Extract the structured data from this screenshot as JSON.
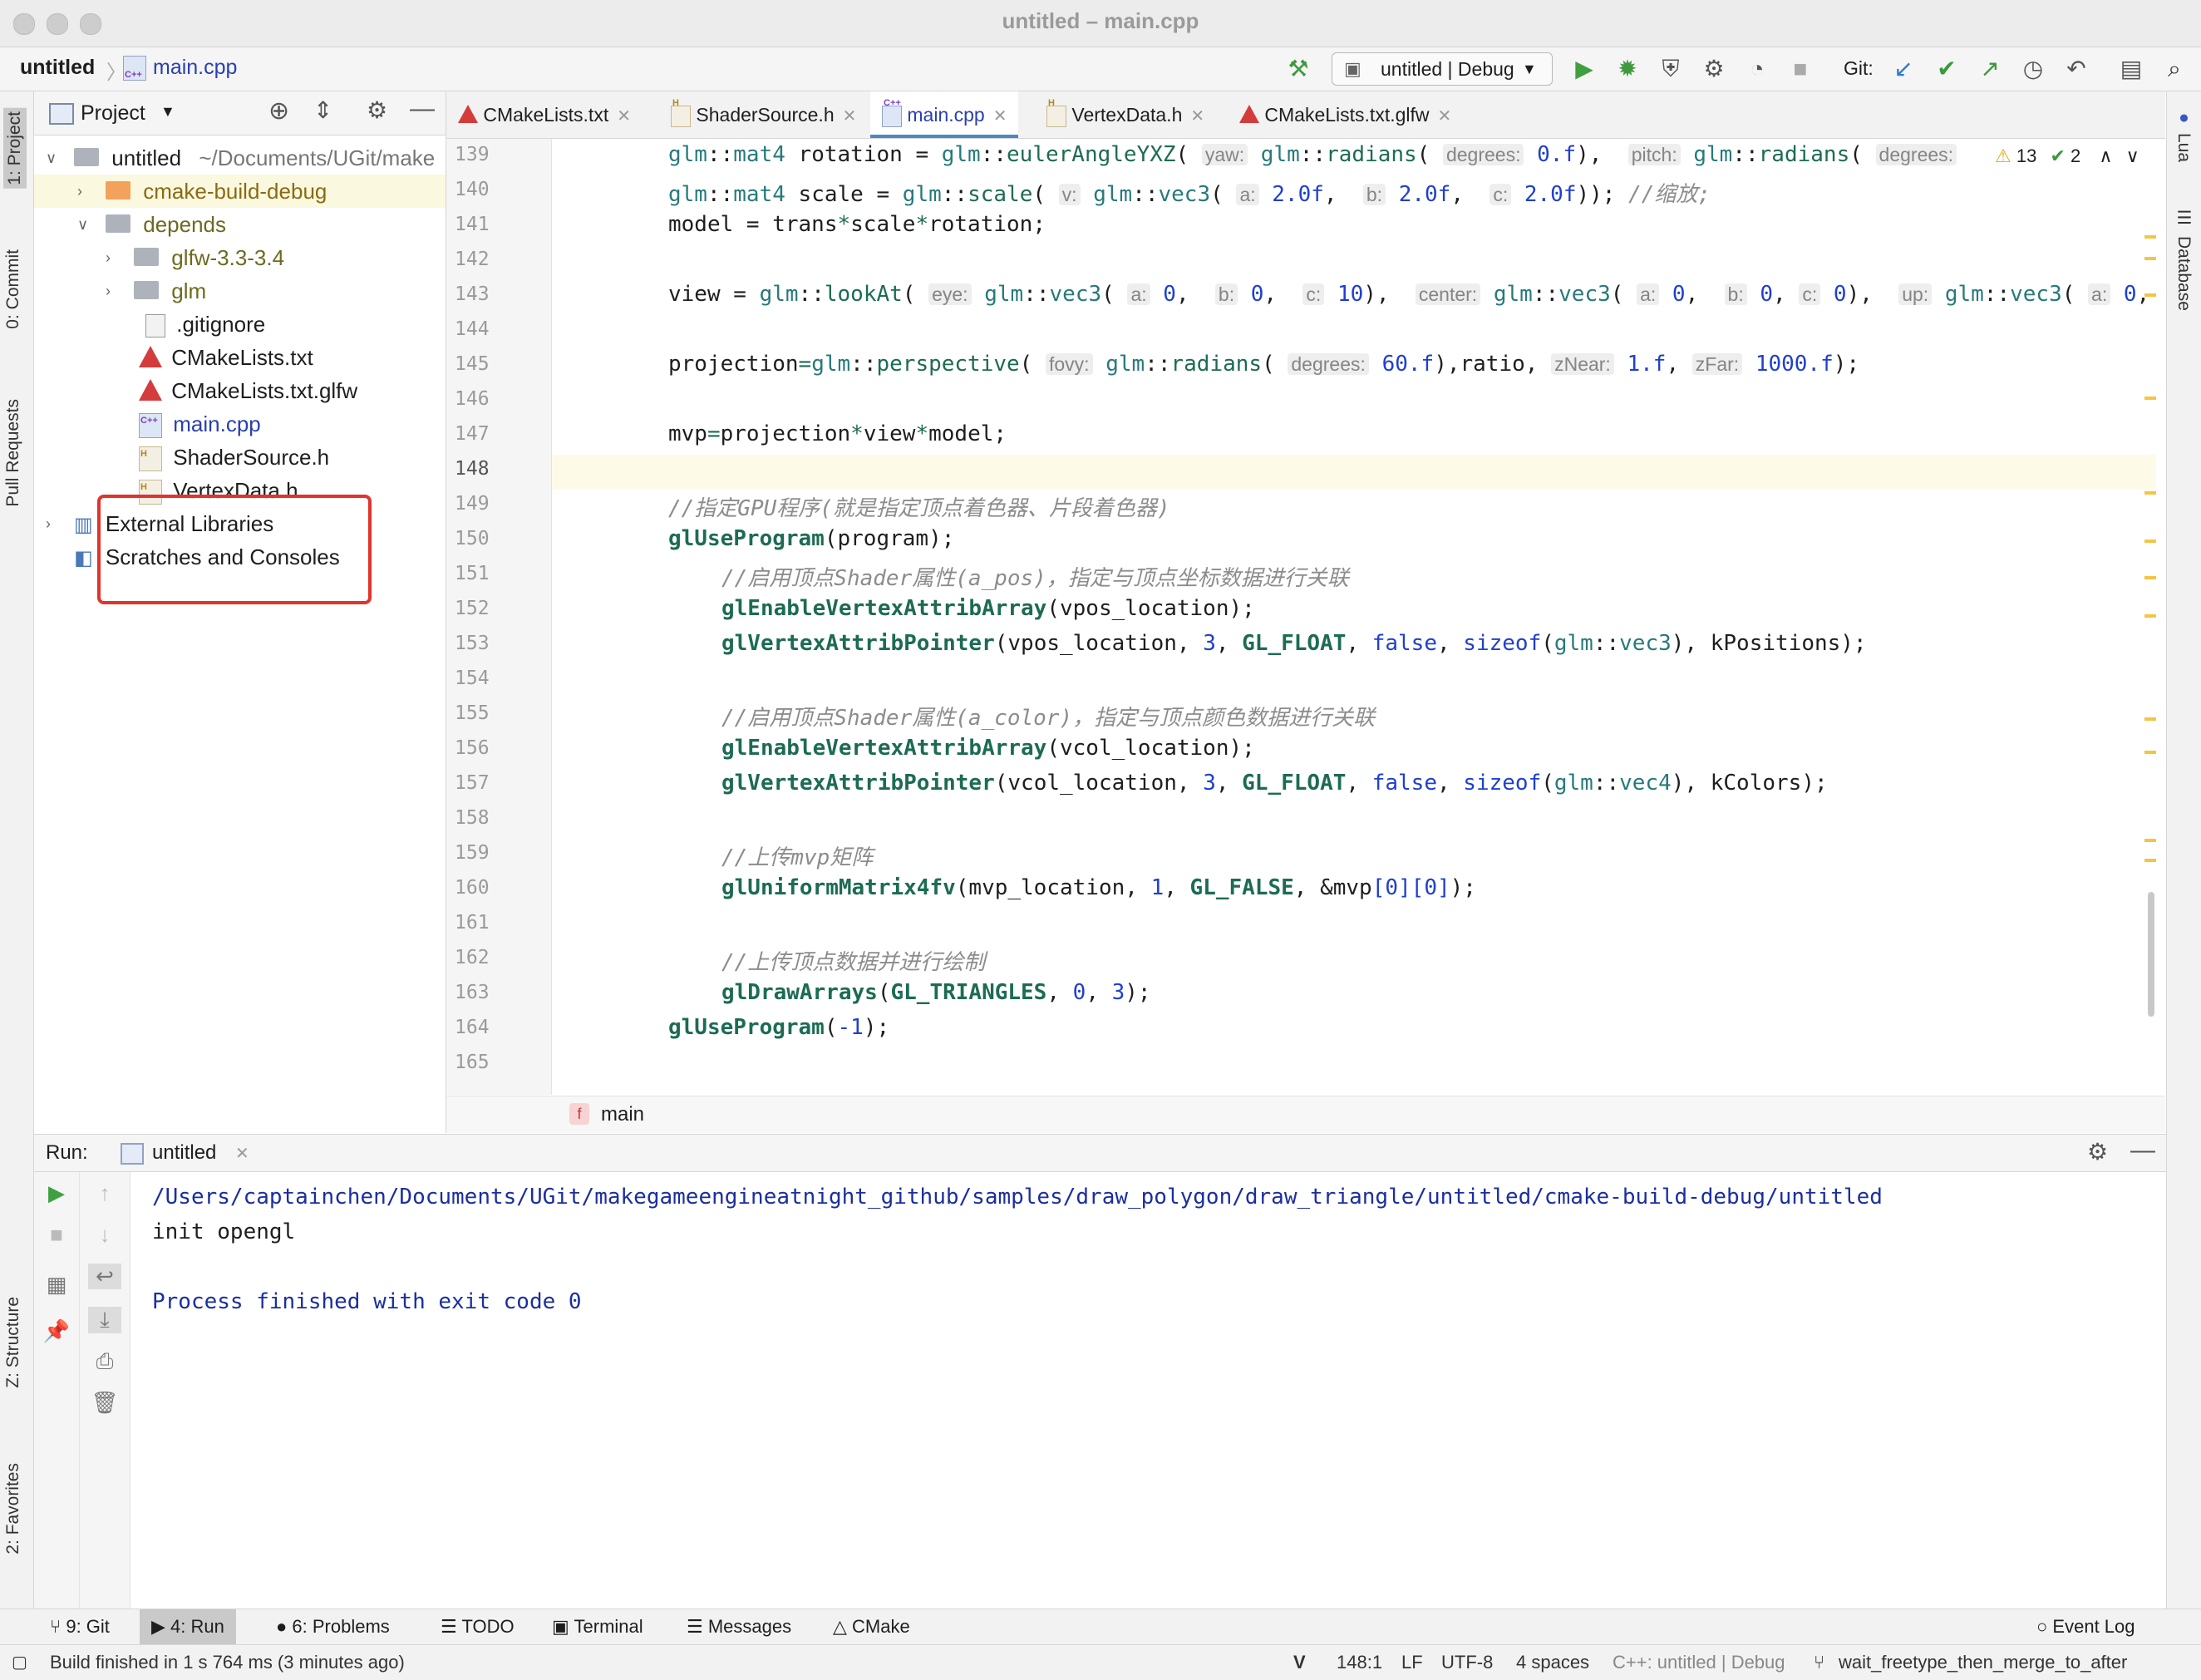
{
  "window": {
    "title": "untitled – main.cpp"
  },
  "navbar": {
    "project": "untitled",
    "file": "main.cpp",
    "run_config": "untitled | Debug",
    "git_label": "Git:"
  },
  "left_strip": {
    "project": "1: Project",
    "commit": "0: Commit",
    "pull_requests": "Pull Requests",
    "structure": "Z: Structure",
    "favorites": "2: Favorites"
  },
  "right_strip": {
    "lua": "Lua",
    "database": "Database"
  },
  "project_panel": {
    "title": "Project",
    "tree": [
      {
        "label": "untitled",
        "path": "~/Documents/UGit/make"
      },
      {
        "label": "cmake-build-debug"
      },
      {
        "label": "depends"
      },
      {
        "label": "glfw-3.3-3.4"
      },
      {
        "label": "glm"
      },
      {
        "label": ".gitignore"
      },
      {
        "label": "CMakeLists.txt"
      },
      {
        "label": "CMakeLists.txt.glfw"
      },
      {
        "label": "main.cpp"
      },
      {
        "label": "ShaderSource.h"
      },
      {
        "label": "VertexData.h"
      },
      {
        "label": "External Libraries"
      },
      {
        "label": "Scratches and Consoles"
      }
    ]
  },
  "tabs": [
    {
      "label": "CMakeLists.txt"
    },
    {
      "label": "ShaderSource.h"
    },
    {
      "label": "main.cpp"
    },
    {
      "label": "VertexData.h"
    },
    {
      "label": "CMakeLists.txt.glfw"
    }
  ],
  "inspections": {
    "warnings": "13",
    "ok": "2"
  },
  "editor": {
    "line_numbers": [
      "139",
      "140",
      "141",
      "142",
      "143",
      "144",
      "145",
      "146",
      "147",
      "148",
      "149",
      "150",
      "151",
      "152",
      "153",
      "154",
      "155",
      "156",
      "157",
      "158",
      "159",
      "160",
      "161",
      "162",
      "163",
      "164",
      "165"
    ],
    "comments": {
      "c140": "//缩放;",
      "c149": "//指定GPU程序(就是指定顶点着色器、片段着色器)",
      "c151": "//启用顶点Shader属性(a_pos)，指定与顶点坐标数据进行关联",
      "c155": "//启用顶点Shader属性(a_color)，指定与顶点颜色数据进行关联",
      "c159": "//上传mvp矩阵",
      "c162": "//上传顶点数据并进行绘制"
    },
    "breadcrumb": "main"
  },
  "run_panel": {
    "label": "Run:",
    "tab": "untitled",
    "output": [
      "/Users/captainchen/Documents/UGit/makegameengineatnight_github/samples/draw_polygon/draw_triangle/untitled/cmake-build-debug/untitled",
      "init opengl",
      "",
      "Process finished with exit code 0"
    ]
  },
  "tool_windows": [
    "9: Git",
    "4: Run",
    "6: Problems",
    "TODO",
    "Terminal",
    "Messages",
    "CMake",
    "Event Log"
  ],
  "status_bar": {
    "message": "Build finished in 1 s 764 ms (3 minutes ago)",
    "position": "148:1",
    "line_sep": "LF",
    "encoding": "UTF-8",
    "indent": "4 spaces",
    "context": "C++: untitled | Debug",
    "branch": "wait_freetype_then_merge_to_after"
  }
}
